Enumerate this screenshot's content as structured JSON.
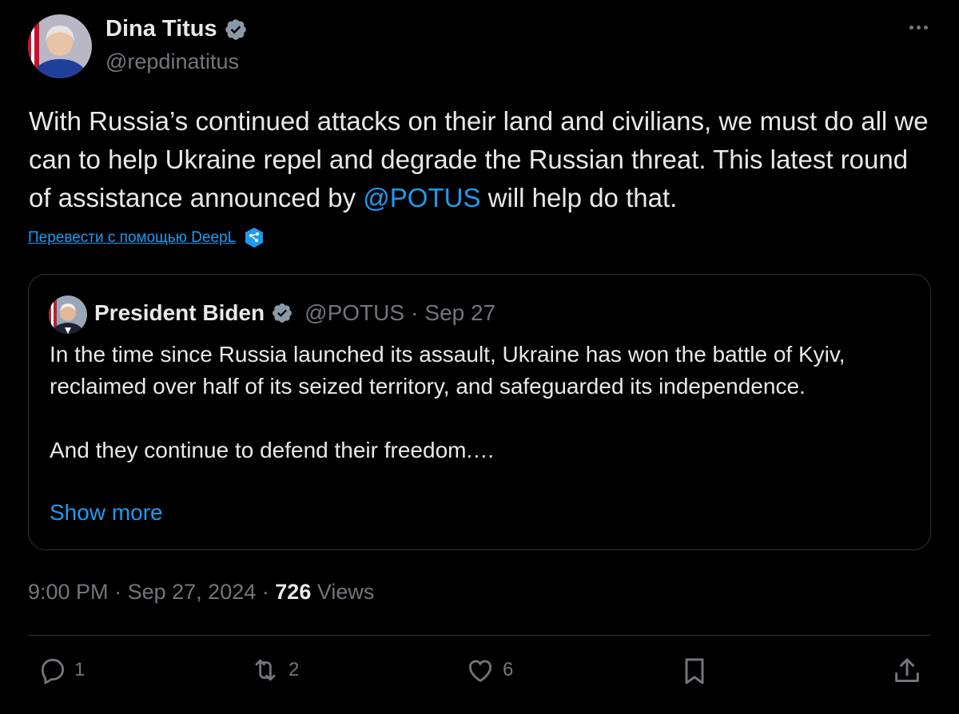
{
  "author": {
    "name": "Dina Titus",
    "handle": "@repdinatitus",
    "verified": true
  },
  "tweet": {
    "text_before": "With Russia’s continued attacks on their land and civilians, we must do all we can to help Ukraine repel and degrade the Russian threat. This latest round of assistance announced by ",
    "mention": "@POTUS",
    "text_after": " will help do that."
  },
  "translate": {
    "label": "Перевести с помощью DeepL",
    "icon": "deepl-icon"
  },
  "quote": {
    "name": "President Biden",
    "handle": "@POTUS",
    "separator": "·",
    "date": "Sep 27",
    "paragraph1": "In the time since Russia launched its assault, Ukraine has won the battle of Kyiv, reclaimed over half of its seized territory, and safeguarded its independence.",
    "paragraph2": "And they continue to defend their freedom.…",
    "show_more": "Show more"
  },
  "meta": {
    "time": "9:00 PM",
    "separator": "·",
    "date": "Sep 27, 2024",
    "views_count": "726",
    "views_label": "Views"
  },
  "actions": {
    "replies": "1",
    "reposts": "2",
    "likes": "6"
  },
  "colors": {
    "background": "#000000",
    "text": "#e7e9ea",
    "muted": "#71767b",
    "accent": "#1d9bf0",
    "border": "#2f3336"
  }
}
